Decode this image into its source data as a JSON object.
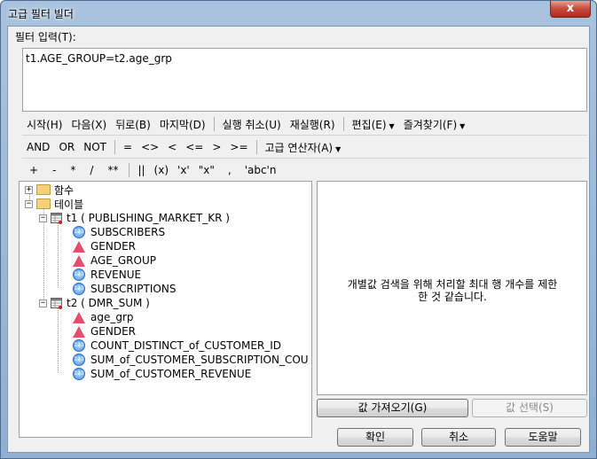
{
  "window": {
    "title": "고급 필터 빌더",
    "close_label": "x"
  },
  "filter": {
    "label": "필터 입력(T):",
    "value": "t1.AGE_GROUP=t2.age_grp"
  },
  "toolbar1": {
    "start": "시작(H)",
    "next": "다음(X)",
    "back": "뒤로(B)",
    "last": "마지막(D)",
    "undo": "실행 취소(U)",
    "redo": "재실행(R)",
    "edit": "편집(E)",
    "favorites": "즐겨찾기(F)"
  },
  "toolbar2": {
    "and": "AND",
    "or": "OR",
    "not": "NOT",
    "eq": "=",
    "ne": "<>",
    "lt": "<",
    "le": "<=",
    "gt": ">",
    "ge": ">=",
    "advanced": "고급 연산자(A)"
  },
  "toolbar3": {
    "plus": "+",
    "minus": "-",
    "mult": "*",
    "div": "/",
    "pow": "**",
    "concat": "||",
    "paren": "(x)",
    "squote": "'x'",
    "dquote": "\"x\"",
    "comma": ",",
    "string": "'abc'n"
  },
  "tree": {
    "functions": "함수",
    "tables": "테이블",
    "t1": {
      "label": "t1 ( PUBLISHING_MARKET_KR )",
      "fields": [
        {
          "name": "SUBSCRIBERS",
          "type": "num"
        },
        {
          "name": "GENDER",
          "type": "str"
        },
        {
          "name": "AGE_GROUP",
          "type": "str"
        },
        {
          "name": "REVENUE",
          "type": "num"
        },
        {
          "name": "SUBSCRIPTIONS",
          "type": "num"
        }
      ]
    },
    "t2": {
      "label": "t2 ( DMR_SUM )",
      "fields": [
        {
          "name": "age_grp",
          "type": "str"
        },
        {
          "name": "GENDER",
          "type": "str"
        },
        {
          "name": "COUNT_DISTINCT_of_CUSTOMER_ID",
          "type": "num"
        },
        {
          "name": "SUM_of_CUSTOMER_SUBSCRIPTION_COU",
          "type": "num"
        },
        {
          "name": "SUM_of_CUSTOMER_REVENUE",
          "type": "num"
        }
      ]
    }
  },
  "info": {
    "line1": "개별값 검색을 위해 처리할 최대 행 개수를 제한",
    "line2": "한 것 같습니다."
  },
  "buttons": {
    "get_values": "값 가져오기(G)",
    "select_value": "값 선택(S)",
    "ok": "확인",
    "cancel": "취소",
    "help": "도움말"
  }
}
